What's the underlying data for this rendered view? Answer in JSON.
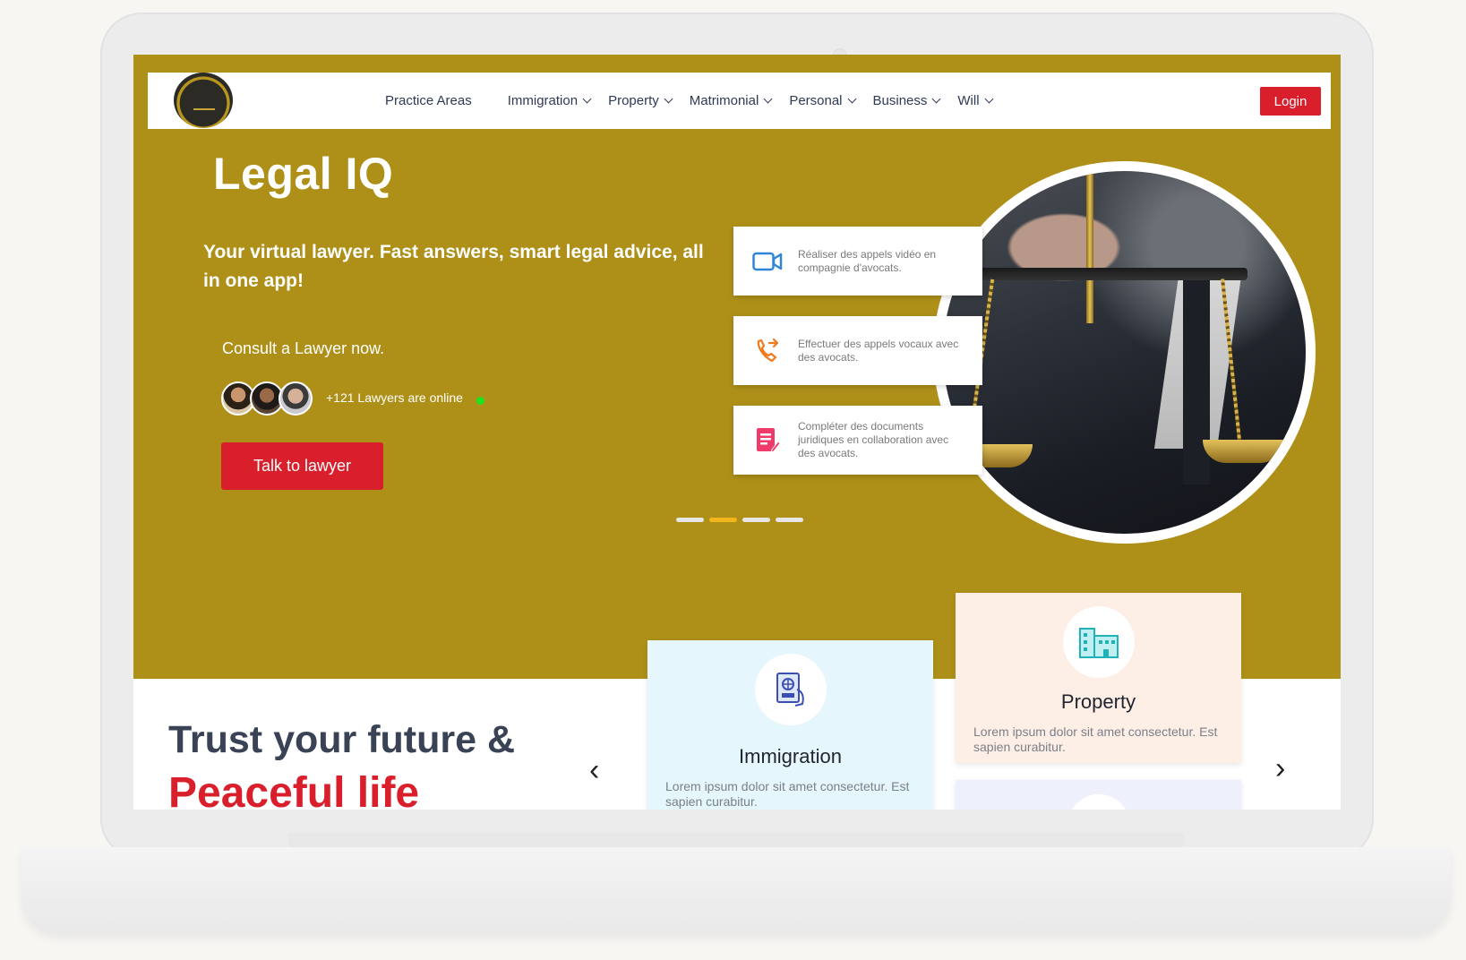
{
  "colors": {
    "brand_gold": "#ae9019",
    "accent_red": "#d91f2b",
    "online_green": "#1ee31e",
    "active_dot": "#f2b51c"
  },
  "nav": {
    "items": [
      {
        "label": "Practice Areas",
        "has_dropdown": false
      },
      {
        "label": "Immigration",
        "has_dropdown": true
      },
      {
        "label": "Property",
        "has_dropdown": true
      },
      {
        "label": "Matrimonial",
        "has_dropdown": true
      },
      {
        "label": "Personal",
        "has_dropdown": true
      },
      {
        "label": "Business",
        "has_dropdown": true
      },
      {
        "label": "Will",
        "has_dropdown": true
      }
    ],
    "login_label": "Login"
  },
  "hero": {
    "title": "Legal IQ",
    "subtitle": "Your virtual lawyer. Fast answers, smart legal advice, all in one app!",
    "consult_text": "Consult a Lawyer now.",
    "online_text": "+121 Lawyers are online",
    "cta_label": "Talk to lawyer",
    "features": [
      {
        "icon": "video-camera-icon",
        "text": "Réaliser des appels vidéo en compagnie d'avocats."
      },
      {
        "icon": "phone-call-icon",
        "text": "Effectuer des appels vocaux avec des avocats."
      },
      {
        "icon": "document-edit-icon",
        "text": "Compléter des documents juridiques en collaboration avec des avocats."
      }
    ],
    "slider": {
      "total": 4,
      "active_index": 1
    }
  },
  "trust": {
    "line1": "Trust your future &",
    "line2": "Peaceful life"
  },
  "cards": [
    {
      "icon": "passport-icon",
      "title": "Immigration",
      "desc": "Lorem ipsum dolor sit amet consectetur. Est sapien curabitur."
    },
    {
      "icon": "buildings-icon",
      "title": "Property",
      "desc": "Lorem ipsum dolor sit amet consectetur. Est sapien curabitur."
    }
  ],
  "carousel": {
    "prev_glyph": "‹",
    "next_glyph": "›"
  }
}
